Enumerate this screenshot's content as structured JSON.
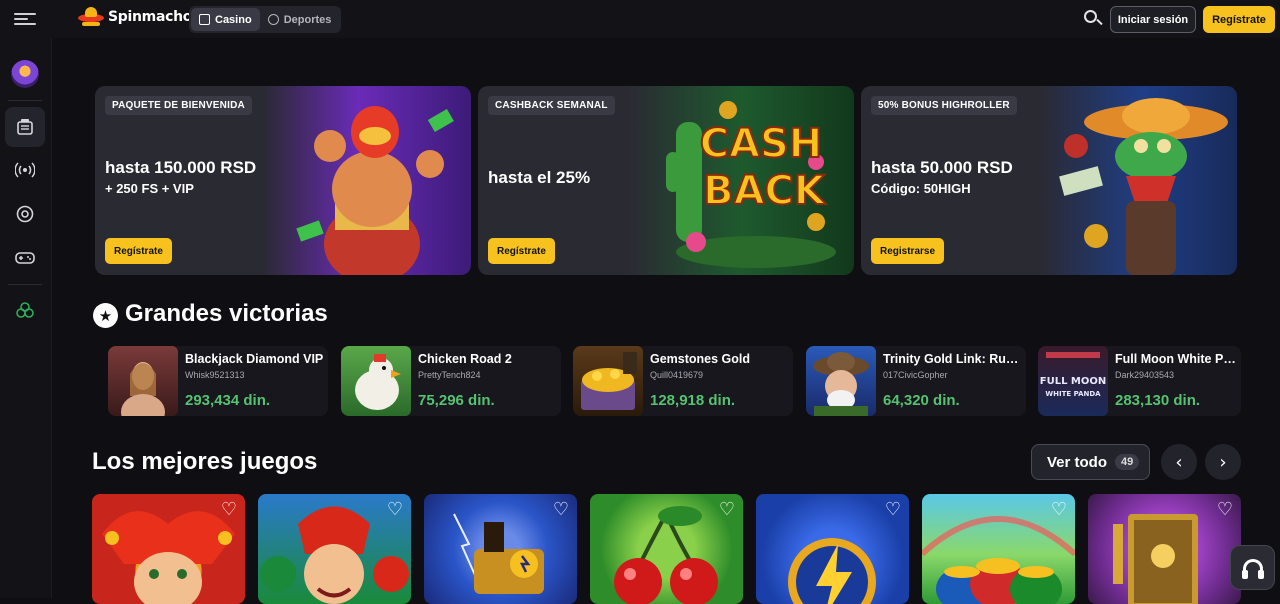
{
  "brand": {
    "name": "Spinmacho"
  },
  "nav": {
    "modes": [
      {
        "label": "Casino",
        "icon": "casino-icon"
      },
      {
        "label": "Deportes",
        "icon": "sports-ball-icon"
      }
    ],
    "login_label": "Iniciar sesión",
    "register_label": "Regístrate"
  },
  "sidebar": {
    "items": [
      {
        "icon": "avatar-icon"
      },
      {
        "icon": "slot-machine-icon"
      },
      {
        "icon": "live-broadcast-icon"
      },
      {
        "icon": "sports-icon"
      },
      {
        "icon": "gamepad-icon"
      },
      {
        "icon": "clover-icon",
        "color": "#2fae5a"
      }
    ]
  },
  "promos": [
    {
      "badge": "PAQUETE DE BIENVENIDA",
      "title": "hasta 150.000 RSD",
      "subtitle": "+ 250 FS + VIP",
      "button": "Regístrate"
    },
    {
      "badge": "CASHBACK SEMANAL",
      "title": "hasta el 25%",
      "subtitle": "",
      "button": "Regístrate",
      "art_text_1": "CASH",
      "art_text_2": "BACK"
    },
    {
      "badge": "50% BONUS HIGHROLLER",
      "title": "hasta 50.000 RSD",
      "subtitle": "Código: 50HIGH",
      "button": "Registrarse"
    }
  ],
  "big_wins": {
    "title": "Grandes victorias",
    "items": [
      {
        "game": "Blackjack Diamond VIP",
        "user": "Whisk9521313",
        "amount": "293,434 din."
      },
      {
        "game": "Chicken Road 2",
        "user": "PrettyTench824",
        "amount": "75,296 din."
      },
      {
        "game": "Gemstones Gold",
        "user": "Quill0419679",
        "amount": "128,918 din."
      },
      {
        "game": "Trinity Gold Link: Running Wins",
        "user": "017CivicGopher",
        "amount": "64,320 din."
      },
      {
        "game": "Full Moon White Panda",
        "user": "Dark29403543",
        "amount": "283,130 din.",
        "thumb_text_1": "FULL MOON",
        "thumb_text_2": "WHITE PANDA"
      }
    ]
  },
  "best_games": {
    "title": "Los mejores juegos",
    "see_all_label": "Ver todo",
    "see_all_count": "49",
    "tiles": [
      {
        "theme": "joker",
        "color": "#c8251d"
      },
      {
        "theme": "jokers-crew",
        "color": "#1a8a3a"
      },
      {
        "theme": "train",
        "color": "#2a55c8"
      },
      {
        "theme": "cherries",
        "color": "#2e8d2a"
      },
      {
        "theme": "lightning",
        "color": "#1a3fa8"
      },
      {
        "theme": "pots-of-gold",
        "color": "#2e9a36"
      },
      {
        "theme": "book",
        "color": "#6a2a8a"
      }
    ]
  },
  "colors": {
    "accent": "#f7c21d",
    "win_green": "#56c271",
    "background": "#0f0f13"
  }
}
